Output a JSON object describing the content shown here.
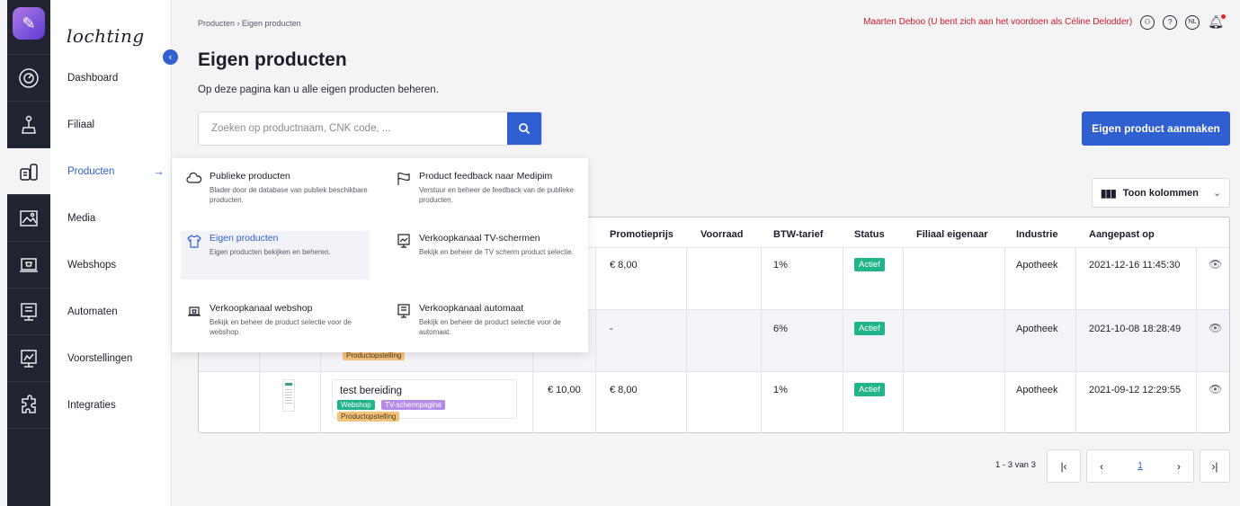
{
  "nav": {
    "brand": "lochting",
    "items": [
      {
        "label": "Dashboard"
      },
      {
        "label": "Filiaal"
      },
      {
        "label": "Producten"
      },
      {
        "label": "Media"
      },
      {
        "label": "Webshops"
      },
      {
        "label": "Automaten"
      },
      {
        "label": "Voorstellingen"
      },
      {
        "label": "Integraties"
      }
    ],
    "active_arrow": "→",
    "collapse_icon": "‹"
  },
  "header": {
    "breadcrumb": "Producten  ›  Eigen producten",
    "user_text": "Maarten Deboo (U bent zich aan het voordoen als Céline Delodder)",
    "lang": "NL",
    "help": "?"
  },
  "page": {
    "title": "Eigen producten",
    "subtitle": "Op deze pagina kan u alle eigen producten beheren.",
    "search_placeholder": "Zoeken op productnaam, CNK code, ...",
    "create_button": "Eigen product aanmaken",
    "columns_button": "Toon kolommen"
  },
  "menu": [
    {
      "title": "Publieke producten",
      "desc": "Blader door de database van publiek beschikbare producten.",
      "icon": "cloud-icon"
    },
    {
      "title": "Product feedback naar Medipim",
      "desc": "Verstuur en beheer de feedback van de publieke producten.",
      "icon": "flag-icon"
    },
    {
      "title": "Eigen producten",
      "desc": "Eigen producten bekijken en beheren.",
      "icon": "shirt-icon"
    },
    {
      "title": "Verkoopkanaal TV-schermen",
      "desc": "Bekijk en beheer de TV scherm product selectie.",
      "icon": "tv-screen-icon"
    },
    {
      "title": "Verkoopkanaal webshop",
      "desc": "Bekijk en beheer de product selectie voor de webshop.",
      "icon": "laptop-icon"
    },
    {
      "title": "Verkoopkanaal automaat",
      "desc": "Bekijk en beheer de product selectie voor de automaat.",
      "icon": "vending-machine-icon"
    }
  ],
  "table": {
    "headers": [
      "Promotieprijs",
      "Voorraad",
      "BTW-tarief",
      "Status",
      "Filiaal eigenaar",
      "Industrie",
      "Aangepast op"
    ],
    "rows": [
      {
        "price": "",
        "promo": "€ 8,00",
        "stock": "",
        "vat": "1%",
        "status": "Actief",
        "owner": "",
        "industry": "Apotheek",
        "modified": "2021-12-16 11:45:30"
      },
      {
        "price": "",
        "promo": "-",
        "stock": "",
        "vat": "6%",
        "status": "Actief",
        "owner": "",
        "industry": "Apotheek",
        "modified": "2021-10-08 18:28:49"
      },
      {
        "price": "€ 10,00",
        "promo": "€ 8,00",
        "stock": "",
        "vat": "1%",
        "status": "Actief",
        "owner": "",
        "industry": "Apotheek",
        "modified": "2021-09-12 12:29:55",
        "name": "test bereiding"
      }
    ],
    "row2_tag": "Productopstelling",
    "row3_tags": [
      "Webshop",
      "TV-schermpagina",
      "Productopstelling"
    ]
  },
  "pagination": {
    "info": "1 - 3 van 3",
    "current": "1",
    "first": "|‹",
    "prev": "‹",
    "next": "›",
    "last": "›|"
  },
  "colors": {
    "accent": "#2f5fd0",
    "active_badge": "#21b38a",
    "user_text": "#d11a2a"
  }
}
